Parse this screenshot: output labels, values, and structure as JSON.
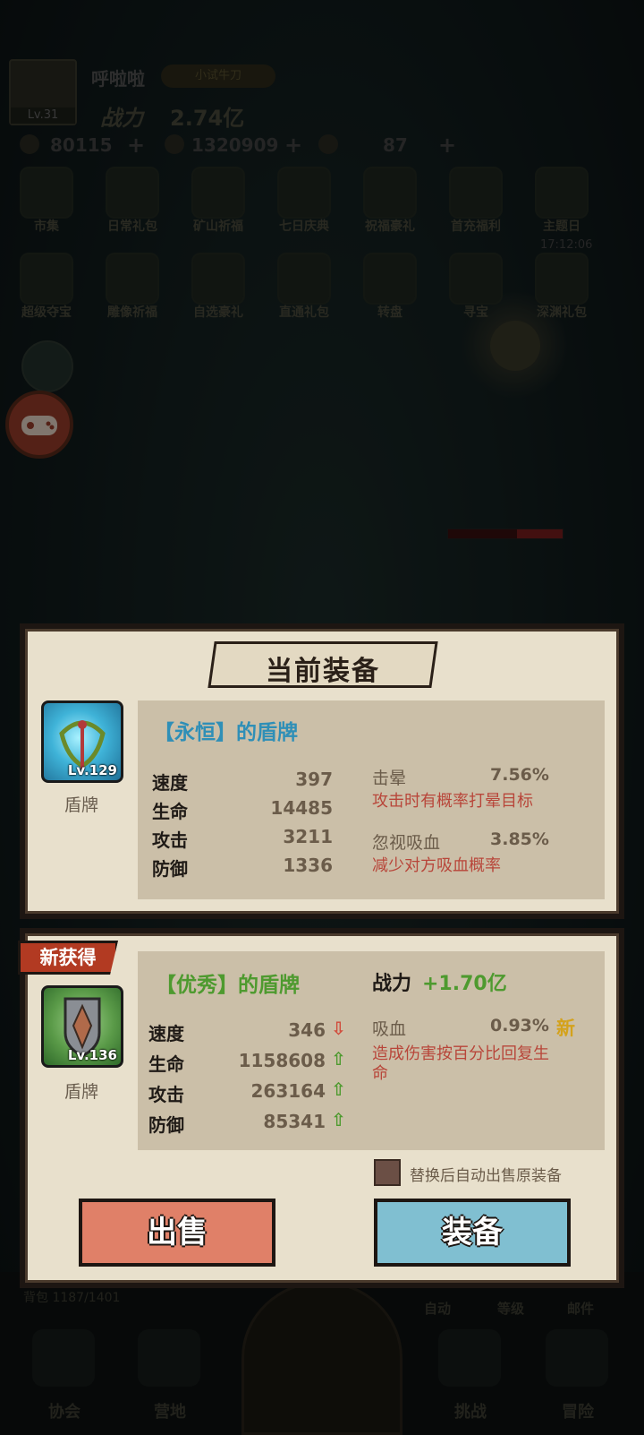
{
  "hud": {
    "player_level": "Lv.31",
    "player_name": "呼啦啦",
    "title_badge": "小试牛刀",
    "power_label": "战力",
    "power_value": "2.74亿",
    "diamonds": "80115",
    "gold": "1320909",
    "stamina": "87",
    "plus": "+"
  },
  "menu": {
    "row1": [
      "市集",
      "日常礼包",
      "矿山祈福",
      "七日庆典",
      "祝福豪礼",
      "首充福利",
      "主题日"
    ],
    "row1_timer": "17:12:06",
    "row2": [
      "超级夺宝",
      "雕像祈福",
      "自选豪礼",
      "直通礼包",
      "转盘",
      "寻宝",
      "深渊礼包"
    ]
  },
  "current": {
    "header": "当前装备",
    "name": "【永恒】的盾牌",
    "level": "Lv.129",
    "type": "盾牌",
    "stats": [
      {
        "label": "速度",
        "value": "397"
      },
      {
        "label": "生命",
        "value": "14485"
      },
      {
        "label": "攻击",
        "value": "3211"
      },
      {
        "label": "防御",
        "value": "1336"
      }
    ],
    "attrs": [
      {
        "name": "击晕",
        "value": "7.56%",
        "desc": "攻击时有概率打晕目标"
      },
      {
        "name": "忽视吸血",
        "value": "3.85%",
        "desc": "减少对方吸血概率"
      }
    ]
  },
  "new_item": {
    "tag": "新获得",
    "name": "【优秀】的盾牌",
    "level": "Lv.136",
    "type": "盾牌",
    "power_label": "战力",
    "power_delta": "+1.70亿",
    "stats": [
      {
        "label": "速度",
        "value": "346",
        "trend": "down"
      },
      {
        "label": "生命",
        "value": "1158608",
        "trend": "up"
      },
      {
        "label": "攻击",
        "value": "263164",
        "trend": "up"
      },
      {
        "label": "防御",
        "value": "85341",
        "trend": "up"
      }
    ],
    "attr": {
      "name": "吸血",
      "value": "0.93%",
      "new_label": "新",
      "desc_line1": "造成伤害按百分比回复生",
      "desc_line2": "命"
    },
    "auto_sell_label": "替换后自动出售原装备",
    "auto_sell_checked": false,
    "sell_button": "出售",
    "equip_button": "装备"
  },
  "bottom": {
    "bag": "背包 1187/1401",
    "tabs": [
      "自动",
      "等级",
      "邮件"
    ],
    "nav": [
      "协会",
      "营地",
      "挑战",
      "冒险"
    ]
  },
  "colors": {
    "up": "#4e9a2f",
    "down": "#d14a3a",
    "current_name": "#2f8fb7",
    "new_name": "#4e9a2f"
  }
}
